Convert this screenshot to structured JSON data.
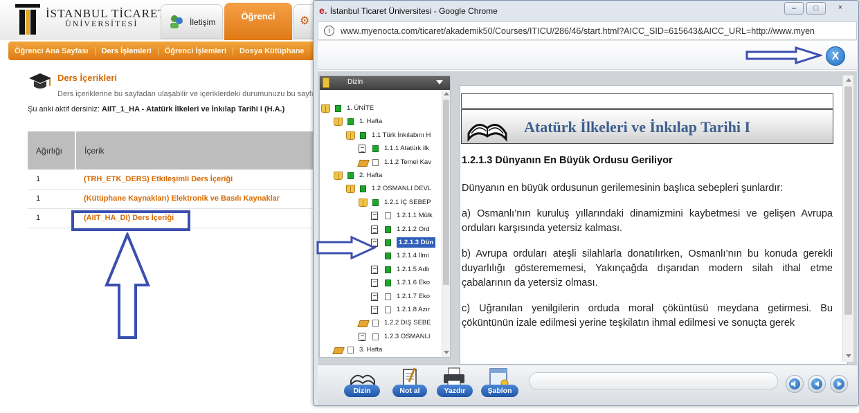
{
  "portal": {
    "logo": {
      "line1": "İSTANBUL TİCARET",
      "line2": "ÜNİVERSİTESİ"
    },
    "tabs": [
      {
        "label": "İletişim"
      },
      {
        "label": "Öğrenci"
      }
    ],
    "menu": [
      "Öğrenci Ana Sayfası",
      "Ders İşlemleri",
      "Öğrenci İşlemleri",
      "Dosya Kütüphane"
    ],
    "section_title": "Ders İçerikleri",
    "section_desc": "Ders içeriklerine bu sayfadan ulaşabilir ve içeriklerdeki durumunuzu bu sayfa ü",
    "active_course_prefix": "Şu anki aktif dersiniz:",
    "active_course_name": "AIIT_1_HA - Atatürk İlkeleri ve İnkılap Tarihi I (H.A.)",
    "table": {
      "headers": [
        "Ağırlığı",
        "İçerik"
      ],
      "rows": [
        {
          "weight": "1",
          "content": "(TRH_ETK_DERS) Etkileşimli Ders İçeriği"
        },
        {
          "weight": "1",
          "content": "(Kütüphane Kaynakları) Elektronik ve Basılı Kaynaklar"
        },
        {
          "weight": "1",
          "content": "(AIIT_HA_DI) Ders İçeriği"
        }
      ]
    }
  },
  "window": {
    "title": "İstanbul Ticaret Üniversitesi - Google Chrome",
    "url": "www.myenocta.com/ticaret/akademik50/Courses/ITICU/286/46/start.html?AICC_SID=615643&AICC_URL=http://www.myen",
    "close_label": "×",
    "min_label": "–",
    "max_label": "□",
    "xbtn_label": "X"
  },
  "tree": {
    "header": "Dizin",
    "items": [
      {
        "text": "1. ÜNİTE"
      },
      {
        "text": "1. Hafta"
      },
      {
        "text": "1.1 Türk İnkılabını H"
      },
      {
        "text": "1.1.1 Atatürk ilk"
      },
      {
        "text": "1.1.2 Temel Kav"
      },
      {
        "text": "2. Hafta"
      },
      {
        "text": "1.2 OSMANLI DEVL"
      },
      {
        "text": "1.2.1 İÇ SEBEP"
      },
      {
        "text": "1.2.1.1 Mülk"
      },
      {
        "text": "1.2.1.2 Ord"
      },
      {
        "text": "1.2.1.3 Dün"
      },
      {
        "text": "1.2.1.4 İlmi"
      },
      {
        "text": "1.2.1.5 Adlı"
      },
      {
        "text": "1.2.1.6 Eko"
      },
      {
        "text": "1.2.1.7 Eko"
      },
      {
        "text": "1.2.1.8 Azır"
      },
      {
        "text": "1.2.2 DIŞ SEBE"
      },
      {
        "text": "1.2.3 OSMANLI"
      },
      {
        "text": "3. Hafta"
      }
    ]
  },
  "page": {
    "banner_title": "Atatürk İlkeleri ve İnkılap Tarihi I",
    "heading": "1.2.1.3 Dünyanın En Büyük Ordusu Geriliyor",
    "intro": "Dünyanın en büyük ordusunun gerilemesinin başlıca sebepleri şunlardır:",
    "p_a": "a) Osmanlı’nın kuruluş yıllarındaki dinamizmini kaybetmesi ve gelişen Avrupa orduları karşısında yetersiz kalması.",
    "p_b": "b) Avrupa orduları ateşli silahlarla donatılırken, Osmanlı’nın bu konuda gerekli duyarlılığı gösterememesi, Yakınçağda dışarıdan modern silah ithal etme çabalarının da yetersiz olması.",
    "p_c": "c) Uğranılan yenilgilerin orduda moral çöküntüsü meydana getirmesi. Bu çöküntünün izale edilmesi yerine teşkilatın ihmal edilmesi ve sonuçta gerek"
  },
  "toolbar": {
    "buttons": [
      "Dizin",
      "Not al",
      "Yazdır",
      "Şablon"
    ]
  },
  "colors": {
    "accent_orange": "#e07a16",
    "annotation_blue": "#3b4fb0",
    "link_orange": "#d86a00"
  }
}
